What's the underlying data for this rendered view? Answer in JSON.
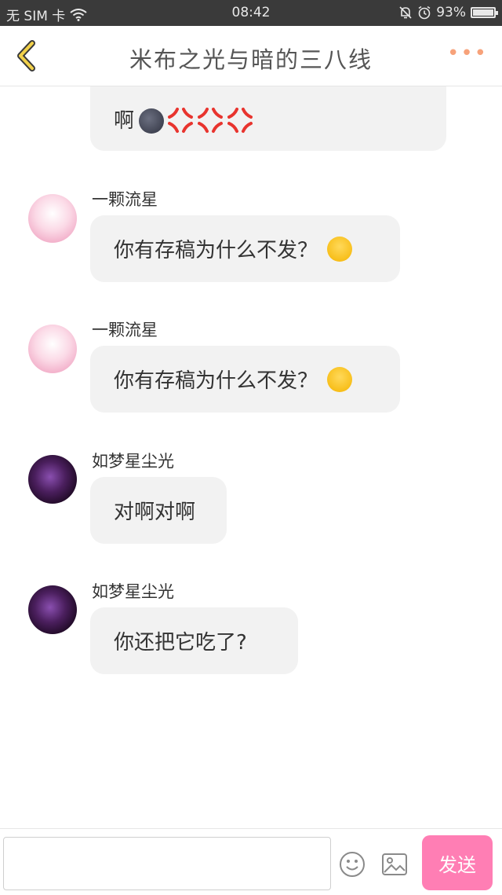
{
  "status_bar": {
    "carrier": "无 SIM 卡",
    "time": "08:42",
    "battery": "93%"
  },
  "header": {
    "title": "米布之光与暗的三八线",
    "back_icon": "chevron-left-icon",
    "more_icon": "more-dots-icon"
  },
  "messages": [
    {
      "text": "啊",
      "emoji": [
        "new-moon-face",
        "anger-symbol",
        "anger-symbol",
        "anger-symbol"
      ]
    },
    {
      "user": "一颗流星",
      "text": "你有存稿为什么不发？",
      "emoji": [
        "tears-of-joy"
      ]
    },
    {
      "user": "一颗流星",
      "text": "你有存稿为什么不发？",
      "emoji": [
        "tears-of-joy"
      ]
    },
    {
      "user": "如梦星尘光",
      "text": "对啊对啊"
    },
    {
      "user": "如梦星尘光",
      "text": "你还把它吃了?"
    }
  ],
  "input_bar": {
    "value": "",
    "send_label": "发送",
    "emoji_icon": "smiley-icon",
    "image_icon": "image-icon"
  },
  "colors": {
    "status_bar_bg": "#3a3a3a",
    "send_button": "#ff7eb4",
    "more_dots": "#f7a27a",
    "back_chevron": "#f2d14a",
    "bubble_bg": "#f2f2f2"
  }
}
